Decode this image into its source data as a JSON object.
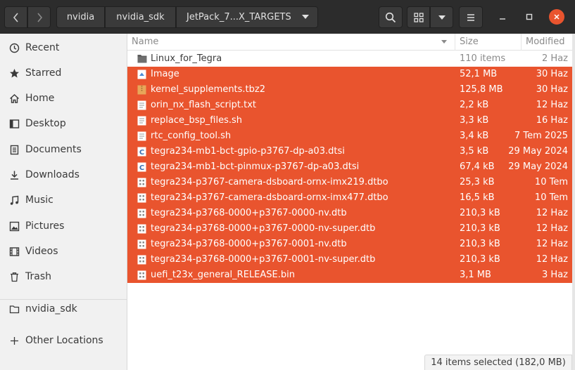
{
  "breadcrumbs": [
    "nvidia",
    "nvidia_sdk",
    "JetPack_7...X_TARGETS"
  ],
  "sidebar": {
    "items": [
      {
        "label": "Recent",
        "icon": "clock-icon"
      },
      {
        "label": "Starred",
        "icon": "star-icon"
      },
      {
        "label": "Home",
        "icon": "home-icon"
      },
      {
        "label": "Desktop",
        "icon": "desktop-icon"
      },
      {
        "label": "Documents",
        "icon": "document-icon"
      },
      {
        "label": "Downloads",
        "icon": "download-icon"
      },
      {
        "label": "Music",
        "icon": "music-icon"
      },
      {
        "label": "Pictures",
        "icon": "picture-icon"
      },
      {
        "label": "Videos",
        "icon": "video-icon"
      }
    ],
    "trash": {
      "label": "Trash",
      "icon": "trash-icon"
    },
    "bookmark": {
      "label": "nvidia_sdk",
      "icon": "folder-icon"
    },
    "other": {
      "label": "Other Locations",
      "icon": "plus-icon"
    }
  },
  "columns": {
    "name": "Name",
    "size": "Size",
    "modified": "Modified"
  },
  "files": [
    {
      "name": "Linux_for_Tegra",
      "size": "110 items",
      "modified": "2 Haz",
      "type": "folder",
      "selected": false
    },
    {
      "name": "Image",
      "size": "52,1 MB",
      "modified": "30 Haz",
      "type": "image",
      "selected": true
    },
    {
      "name": "kernel_supplements.tbz2",
      "size": "125,8 MB",
      "modified": "30 Haz",
      "type": "archive",
      "selected": true
    },
    {
      "name": "orin_nx_flash_script.txt",
      "size": "2,2 kB",
      "modified": "12 Haz",
      "type": "text",
      "selected": true
    },
    {
      "name": "replace_bsp_files.sh",
      "size": "3,3 kB",
      "modified": "16 Haz",
      "type": "text",
      "selected": true
    },
    {
      "name": "rtc_config_tool.sh",
      "size": "3,4 kB",
      "modified": "7 Tem 2025",
      "type": "text",
      "selected": true
    },
    {
      "name": "tegra234-mb1-bct-gpio-p3767-dp-a03.dtsi",
      "size": "3,5 kB",
      "modified": "29 May 2024",
      "type": "c-source",
      "selected": true
    },
    {
      "name": "tegra234-mb1-bct-pinmux-p3767-dp-a03.dtsi",
      "size": "67,4 kB",
      "modified": "29 May 2024",
      "type": "c-source",
      "selected": true
    },
    {
      "name": "tegra234-p3767-camera-dsboard-ornx-imx219.dtbo",
      "size": "25,3 kB",
      "modified": "10 Tem",
      "type": "binary",
      "selected": true
    },
    {
      "name": "tegra234-p3767-camera-dsboard-ornx-imx477.dtbo",
      "size": "16,5 kB",
      "modified": "10 Tem",
      "type": "binary",
      "selected": true
    },
    {
      "name": "tegra234-p3768-0000+p3767-0000-nv.dtb",
      "size": "210,3 kB",
      "modified": "12 Haz",
      "type": "binary",
      "selected": true
    },
    {
      "name": "tegra234-p3768-0000+p3767-0000-nv-super.dtb",
      "size": "210,3 kB",
      "modified": "12 Haz",
      "type": "binary",
      "selected": true
    },
    {
      "name": "tegra234-p3768-0000+p3767-0001-nv.dtb",
      "size": "210,3 kB",
      "modified": "12 Haz",
      "type": "binary",
      "selected": true
    },
    {
      "name": "tegra234-p3768-0000+p3767-0001-nv-super.dtb",
      "size": "210,3 kB",
      "modified": "12 Haz",
      "type": "binary",
      "selected": true
    },
    {
      "name": "uefi_t23x_general_RELEASE.bin",
      "size": "3,1 MB",
      "modified": "3 Haz",
      "type": "binary",
      "selected": true
    }
  ],
  "status": "14 items selected (182,0 MB)",
  "colors": {
    "accent": "#e9542e",
    "header": "#2c2c2c"
  }
}
